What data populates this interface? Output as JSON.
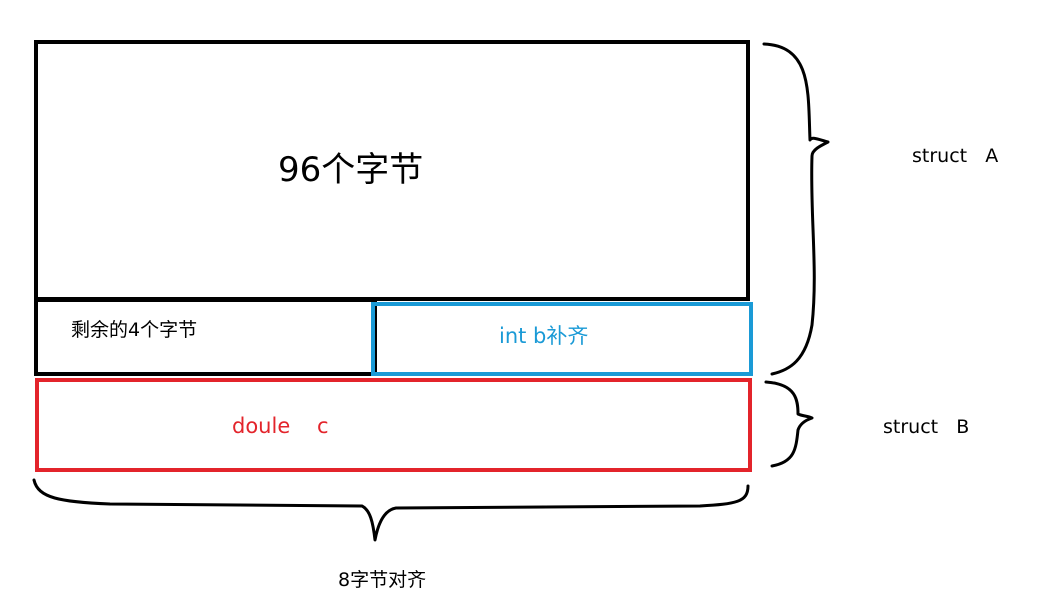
{
  "diagram": {
    "main_block_label": "96个字节",
    "remaining_block_label": "剩余的4个字节",
    "int_block_label": "int b补齐",
    "double_block_label": "doule    c",
    "struct_a_label": "struct   A",
    "struct_b_label": "struct   B",
    "alignment_label": "8字节对齐"
  },
  "colors": {
    "outline": "#000000",
    "int_block": "#1a9ad6",
    "double_block": "#e3242b"
  }
}
